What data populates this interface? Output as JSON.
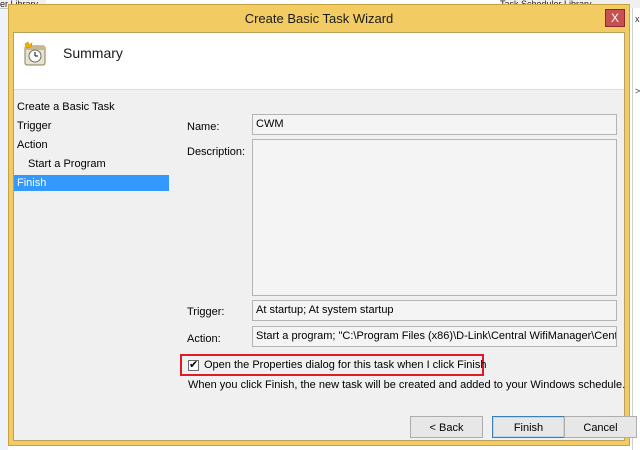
{
  "background": {
    "left_tab_text": "er Library",
    "right_tab_text": "Task Scheduler Library",
    "right_marks": [
      "x",
      ">"
    ]
  },
  "dialog": {
    "title": "Create Basic Task Wizard",
    "close_glyph": "X",
    "header": {
      "title": "Summary",
      "icon": "task-clock-icon"
    },
    "steps": [
      {
        "label": "Create a Basic Task",
        "selected": false
      },
      {
        "label": "Trigger",
        "selected": false
      },
      {
        "label": "Action",
        "selected": false
      },
      {
        "label": "Start a Program",
        "selected": false
      },
      {
        "label": "Finish",
        "selected": true
      }
    ],
    "form": {
      "name_label": "Name:",
      "name_value": "CWM",
      "description_label": "Description:",
      "description_value": "",
      "trigger_label": "Trigger:",
      "trigger_value": "At startup; At system startup",
      "action_label": "Action:",
      "action_value": "Start a program; \"C:\\Program Files (x86)\\D-Link\\Central WifiManager\\Centra"
    },
    "open_properties": {
      "checked": true,
      "label": "Open the Properties dialog for this task when I click Finish"
    },
    "info_text": "When you click Finish, the new task will be created and added to your Windows schedule.",
    "buttons": {
      "back": "< Back",
      "finish": "Finish",
      "cancel": "Cancel"
    }
  }
}
